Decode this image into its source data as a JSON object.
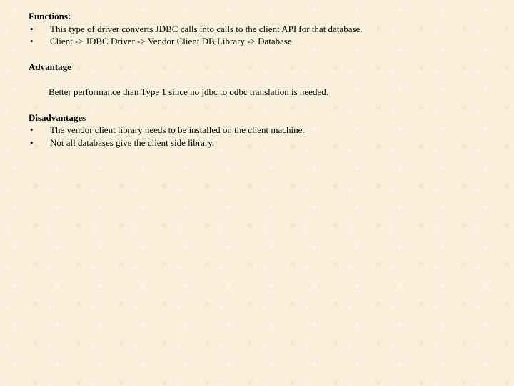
{
  "sections": {
    "functions": {
      "heading": "Functions:",
      "items": [
        "This type of driver converts JDBC calls into calls to the client API for that database.",
        "Client -> JDBC Driver -> Vendor Client DB Library -> Database"
      ]
    },
    "advantage": {
      "heading": "Advantage",
      "paragraph": "Better performance than Type 1 since no jdbc to odbc translation is needed."
    },
    "disadvantages": {
      "heading": "Disadvantages",
      "items": [
        "The vendor client library needs to be installed on the client machine.",
        "Not all databases give the client side library."
      ]
    }
  },
  "bullet_glyph": "•"
}
